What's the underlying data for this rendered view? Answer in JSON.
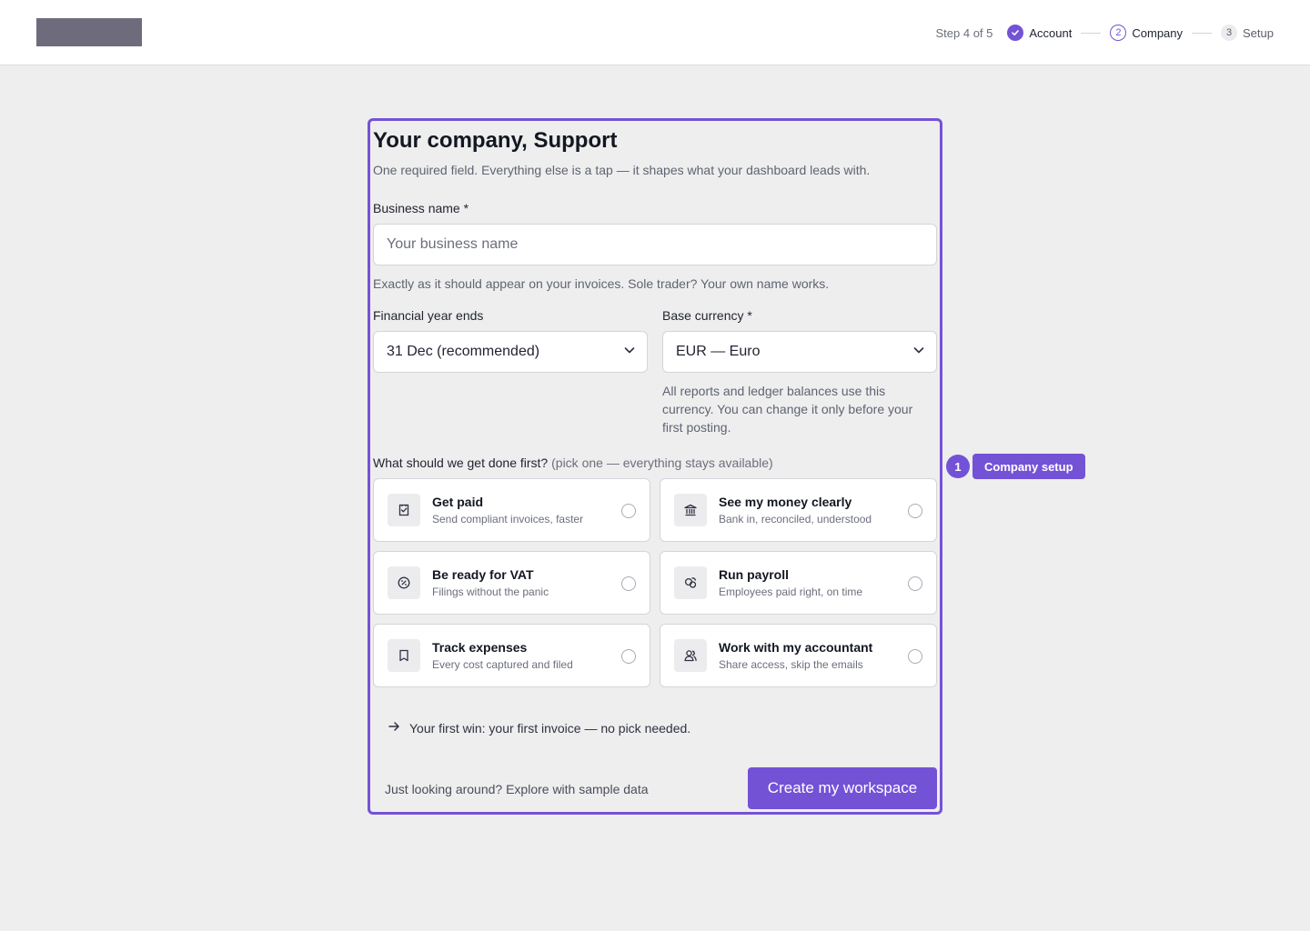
{
  "header": {
    "step_count": "Step 4 of 5",
    "steps": [
      {
        "label": "Account",
        "status": "done"
      },
      {
        "label": "Company",
        "number": "2",
        "status": "current"
      },
      {
        "label": "Setup",
        "number": "3",
        "status": "todo"
      }
    ]
  },
  "form": {
    "title": "Your company, Support",
    "subtitle": "One required field. Everything else is a tap — it shapes what your dashboard leads with.",
    "business_name": {
      "label": "Business name *",
      "placeholder": "Your business name",
      "value": "",
      "help": "Exactly as it should appear on your invoices. Sole trader? Your own name works."
    },
    "financial_year": {
      "label": "Financial year ends",
      "value": "31 Dec (recommended)"
    },
    "base_currency": {
      "label": "Base currency *",
      "value": "EUR — Euro",
      "help": "All reports and ledger balances use this currency. You can change it only before your first posting."
    },
    "goal": {
      "label": "What should we get done first?",
      "hint": "(pick one — everything stays available)",
      "options": [
        {
          "title": "Get paid",
          "desc": "Send compliant invoices, faster",
          "icon": "invoice-check-icon"
        },
        {
          "title": "See my money clearly",
          "desc": "Bank in, reconciled, understood",
          "icon": "bank-icon"
        },
        {
          "title": "Be ready for VAT",
          "desc": "Filings without the panic",
          "icon": "percent-icon"
        },
        {
          "title": "Run payroll",
          "desc": "Employees paid right, on time",
          "icon": "payroll-icon"
        },
        {
          "title": "Track expenses",
          "desc": "Every cost captured and filed",
          "icon": "receipt-icon"
        },
        {
          "title": "Work with my accountant",
          "desc": "Share access, skip the emails",
          "icon": "users-icon"
        }
      ]
    },
    "first_win": "Your first win: your first invoice — no pick needed.",
    "explore_link": "Just looking around? Explore with sample data",
    "submit_label": "Create my workspace"
  },
  "annotation": {
    "number": "1",
    "label": "Company setup"
  },
  "colors": {
    "accent": "#7452d6",
    "background": "#eeeeee",
    "logo": "#6e6c7c"
  }
}
